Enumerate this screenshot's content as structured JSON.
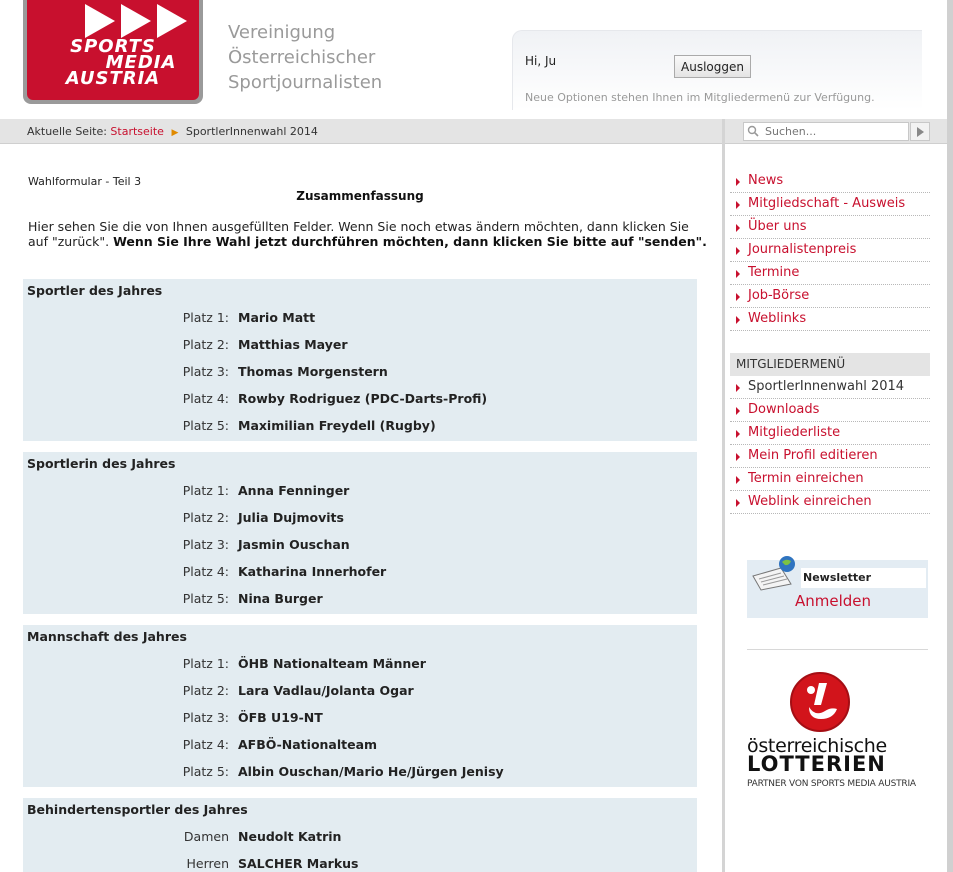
{
  "header": {
    "logo_text": [
      "SPORTS",
      "MEDIA",
      "AUSTRIA"
    ],
    "org_name": [
      "Vereinigung",
      "Österreichischer",
      "Sportjournalisten"
    ],
    "greeting": "Hi, Ju",
    "logout_label": "Ausloggen",
    "note": "Neue Optionen stehen Ihnen im Mitgliedermenü zur Verfügung."
  },
  "breadcrumb": {
    "prefix": "Aktuelle Seite:",
    "home": "Startseite",
    "current": "SportlerInnenwahl 2014"
  },
  "search": {
    "placeholder": "Suchen..."
  },
  "sidebar": {
    "nav_items": [
      {
        "label": "News"
      },
      {
        "label": "Mitgliedschaft - Ausweis"
      },
      {
        "label": "Über uns"
      },
      {
        "label": "Journalistenpreis"
      },
      {
        "label": "Termine"
      },
      {
        "label": "Job-Börse"
      },
      {
        "label": "Weblinks"
      }
    ],
    "members_heading": "MITGLIEDERMENÜ",
    "member_items": [
      {
        "label": "SportlerInnenwahl 2014"
      },
      {
        "label": "Downloads"
      },
      {
        "label": "Mitgliederliste"
      },
      {
        "label": "Mein Profil editieren"
      },
      {
        "label": "Termin einreichen"
      },
      {
        "label": "Weblink einreichen"
      }
    ],
    "newsletter_label": "Newsletter",
    "newsletter_action": "Anmelden",
    "sponsor": {
      "line1": "österreichische",
      "line2": "LOTTERIEN",
      "line3": "PARTNER VON SPORTS MEDIA AUSTRIA"
    }
  },
  "main": {
    "step_label": "Wahlformular - Teil 3",
    "summary_title": "Zusammenfassung",
    "intro_plain": "Hier sehen Sie die von Ihnen ausgefüllten Felder. Wenn Sie noch etwas ändern möchten, dann klicken Sie auf \"zurück\". ",
    "intro_bold": "Wenn Sie Ihre Wahl jetzt durchführen möchten, dann klicken Sie bitte auf \"senden\".",
    "sections": [
      {
        "title": "Sportler des Jahres",
        "rows": [
          {
            "label": "Platz 1:",
            "value": "Mario Matt"
          },
          {
            "label": "Platz 2:",
            "value": "Matthias Mayer"
          },
          {
            "label": "Platz 3:",
            "value": "Thomas Morgenstern"
          },
          {
            "label": "Platz 4:",
            "value": "Rowby Rodriguez (PDC-Darts-Profi)"
          },
          {
            "label": "Platz 5:",
            "value": "Maximilian Freydell (Rugby)"
          }
        ]
      },
      {
        "title": "Sportlerin des Jahres",
        "rows": [
          {
            "label": "Platz 1:",
            "value": "Anna Fenninger"
          },
          {
            "label": "Platz 2:",
            "value": "Julia Dujmovits"
          },
          {
            "label": "Platz 3:",
            "value": "Jasmin Ouschan"
          },
          {
            "label": "Platz 4:",
            "value": "Katharina Innerhofer"
          },
          {
            "label": "Platz 5:",
            "value": "Nina Burger"
          }
        ]
      },
      {
        "title": "Mannschaft des Jahres",
        "rows": [
          {
            "label": "Platz 1:",
            "value": "ÖHB Nationalteam Männer"
          },
          {
            "label": "Platz 2:",
            "value": "Lara Vadlau/Jolanta Ogar"
          },
          {
            "label": "Platz 3:",
            "value": "ÖFB U19-NT"
          },
          {
            "label": "Platz 4:",
            "value": "AFBÖ-Nationalteam"
          },
          {
            "label": "Platz 5:",
            "value": "Albin Ouschan/Mario He/Jürgen Jenisy"
          }
        ]
      },
      {
        "title": "Behindertensportler des Jahres",
        "rows": [
          {
            "label": "Damen",
            "value": "Neudolt Katrin"
          },
          {
            "label": "Herren",
            "value": "SALCHER Markus"
          }
        ]
      }
    ]
  },
  "colors": {
    "brand_red": "#c8102e",
    "panel_bg": "#e3ecf1",
    "bar_gray": "#e4e4e4"
  }
}
